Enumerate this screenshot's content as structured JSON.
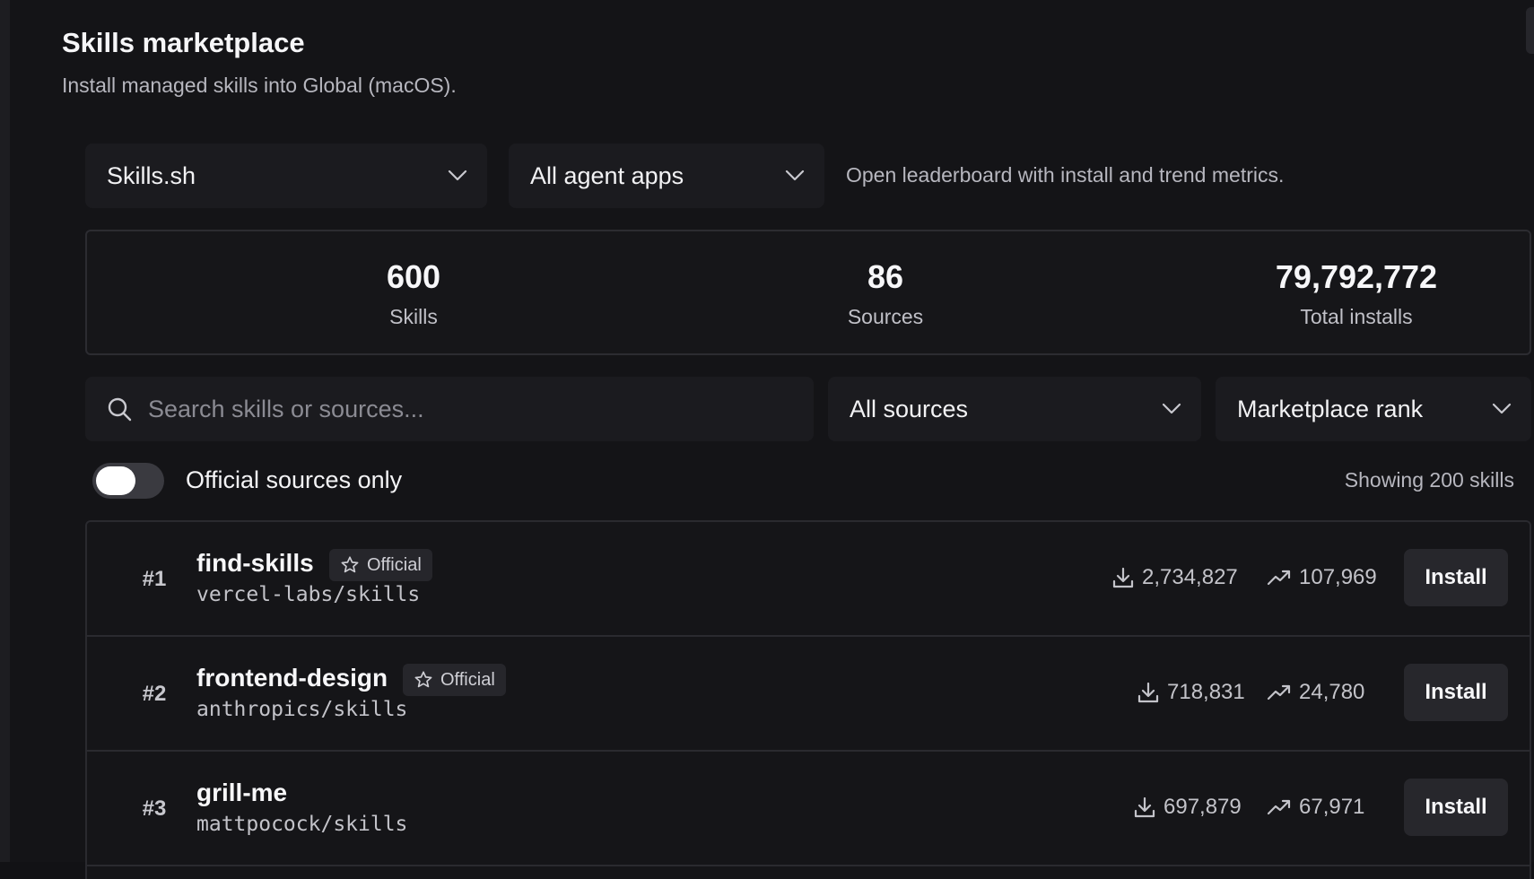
{
  "modal": {
    "title": "Skills marketplace",
    "subtitle": "Install managed skills into Global (macOS).",
    "close_glyph": "×"
  },
  "filters": {
    "provider": "Skills.sh",
    "agent_apps": "All agent apps",
    "hint": "Open leaderboard with install and trend metrics."
  },
  "stats": [
    {
      "value": "600",
      "label": "Skills"
    },
    {
      "value": "86",
      "label": "Sources"
    },
    {
      "value": "79,792,772",
      "label": "Total installs"
    }
  ],
  "search": {
    "placeholder": "Search skills or sources...",
    "value": ""
  },
  "sources_filter": "All sources",
  "sort": "Marketplace rank",
  "official_toggle": {
    "label": "Official sources only",
    "on": false
  },
  "showing_text": "Showing 200 skills",
  "skills": [
    {
      "rank": "#1",
      "name": "find-skills",
      "badge": "Official",
      "source": "vercel-labs/skills",
      "installs": "2,734,827",
      "trend": "107,969",
      "action": "Install"
    },
    {
      "rank": "#2",
      "name": "frontend-design",
      "badge": "Official",
      "source": "anthropics/skills",
      "installs": "718,831",
      "trend": "24,780",
      "action": "Install"
    },
    {
      "rank": "#3",
      "name": "grill-me",
      "badge": "",
      "source": "mattpocock/skills",
      "installs": "697,879",
      "trend": "67,971",
      "action": "Install"
    }
  ],
  "colors": {
    "background": "#141417",
    "panel": "#1b1b1f",
    "text": "#f3f3f5",
    "muted": "#b7b7bf",
    "border": "#2c2c31"
  }
}
